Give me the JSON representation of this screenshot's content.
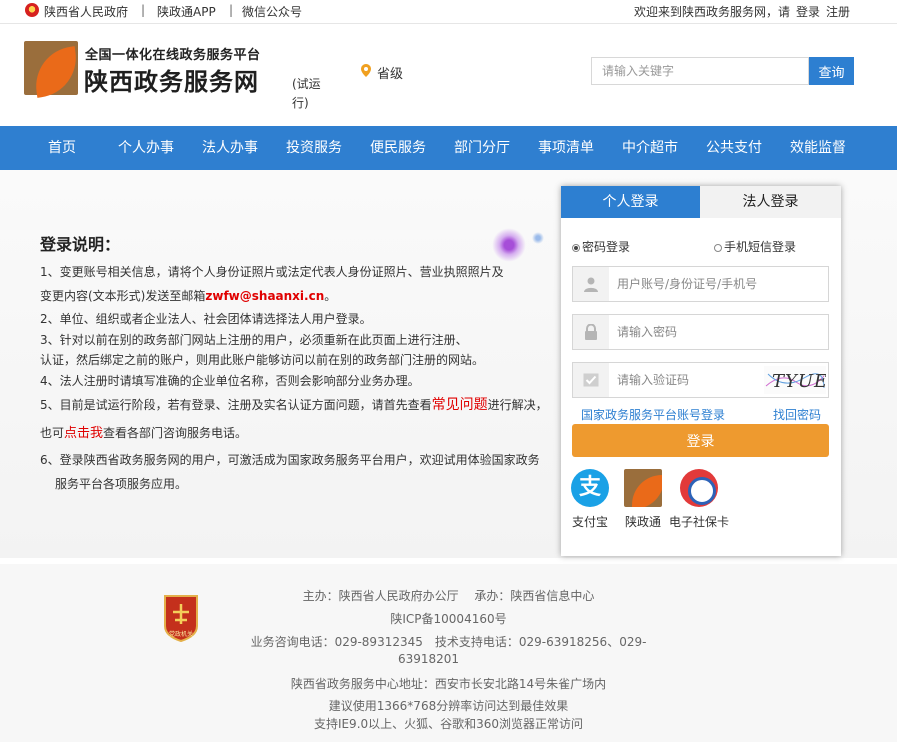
{
  "topbar": {
    "gov_link": "陕西省人民政府",
    "app_link": "陕政通APP",
    "wechat_link": "微信公众号",
    "welcome": "欢迎来到陕西政务服务网，请",
    "login": "登录",
    "register": "注册"
  },
  "header": {
    "subtitle": "全国一体化在线政务服务平台",
    "title": "陕西政务服务网",
    "trial": "(试运行)",
    "location": "省级",
    "search_placeholder": "请输入关键字",
    "search_button": "查询"
  },
  "nav": {
    "items": [
      "首页",
      "个人办事",
      "法人办事",
      "投资服务",
      "便民服务",
      "部门分厅",
      "事项清单",
      "中介超市",
      "公共支付",
      "效能监督"
    ]
  },
  "notes": {
    "title": "登录说明：",
    "line1a": "1、变更账号相关信息，请将个人身份证照片或法定代表人身份证照片、营业执照照片及",
    "line1b_prefix": "变更内容(文本形式)发送至邮箱",
    "line1b_email": "zwfw@shaanxi.cn",
    "line1b_suffix": "。",
    "line2": "2、单位、组织或者企业法人、社会团体请选择法人用户登录。",
    "line3a": "3、针对以前在别的政务部门网站上注册的用户，必须重新在此页面上进行注册、",
    "line3b": "认证，然后绑定之前的账户，则用此账户能够访问以前在别的政务部门注册的网站。",
    "line4": "4、法人注册时请填写准确的企业单位名称，否则会影响部分业务办理。",
    "line5a_prefix": "5、目前是试运行阶段，若有登录、注册及实名认证方面问题，请首先查看",
    "line5a_link": "常见问题",
    "line5a_suffix": "进行解决，",
    "line5b_prefix": "也可",
    "line5b_link": "点击我",
    "line5b_suffix": "查看各部门咨询服务电话。",
    "line6a": "6、登录陕西省政务服务网的用户，可激活成为国家政务服务平台用户，欢迎试用体验国家政务",
    "line6b": "服务平台各项服务应用。"
  },
  "login": {
    "tab_personal": "个人登录",
    "tab_legal": "法人登录",
    "radio_password": "密码登录",
    "radio_sms": "手机短信登录",
    "username_placeholder": "用户账号/身份证号/手机号",
    "password_placeholder": "请输入密码",
    "captcha_placeholder": "请输入验证码",
    "captcha_text": "TYUE",
    "national_link": "国家政务服务平台账号登录",
    "forgot_link": "找回密码",
    "submit": "登录",
    "apps": [
      "支付宝",
      "陕政通",
      "电子社保卡"
    ]
  },
  "footer": {
    "line1": "主办：陕西省人民政府办公厅　 承办：陕西省信息中心",
    "line2": "陕ICP备10004160号",
    "line3": "业务咨询电话：029-89312345　技术支持电话：029-63918256、029-",
    "line3b": "63918201",
    "line4": "陕西省政务服务中心地址：西安市长安北路14号朱雀广场内",
    "line5": "建议使用1366*768分辨率访问达到最佳效果",
    "line6": "支持IE9.0以上、火狐、谷歌和360浏览器正常访问",
    "badge_text": "党政机关"
  },
  "colors": {
    "brand_blue": "#2f7fd0",
    "login_orange": "#ee9a2f",
    "link_red": "#e00000"
  }
}
